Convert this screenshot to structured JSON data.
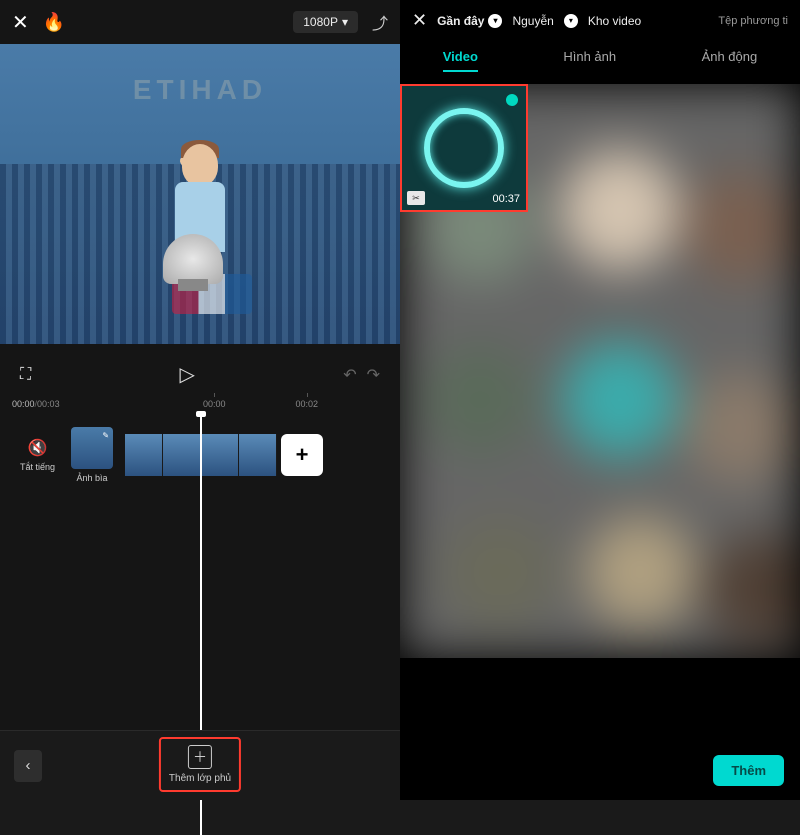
{
  "left": {
    "resolution": "1080P",
    "stadium_banner": "ETIHAD",
    "time": {
      "current": "00:00",
      "total": "00:03",
      "marks": [
        "00:00",
        "00:02"
      ]
    },
    "tools": {
      "mute_label": "Tắt tiếng",
      "cover_label": "Ảnh bìa"
    },
    "overlay_button": "Thêm lớp phủ"
  },
  "right": {
    "header": {
      "close": "✕",
      "recent": "Gần đây",
      "name": "Nguyễn",
      "library": "Kho video",
      "file_method": "Tệp phương ti"
    },
    "tabs": {
      "video": "Video",
      "image": "Hình ảnh",
      "animated": "Ảnh động"
    },
    "media": {
      "duration": "00:37",
      "cut": "✂"
    },
    "add_button": "Thêm"
  }
}
